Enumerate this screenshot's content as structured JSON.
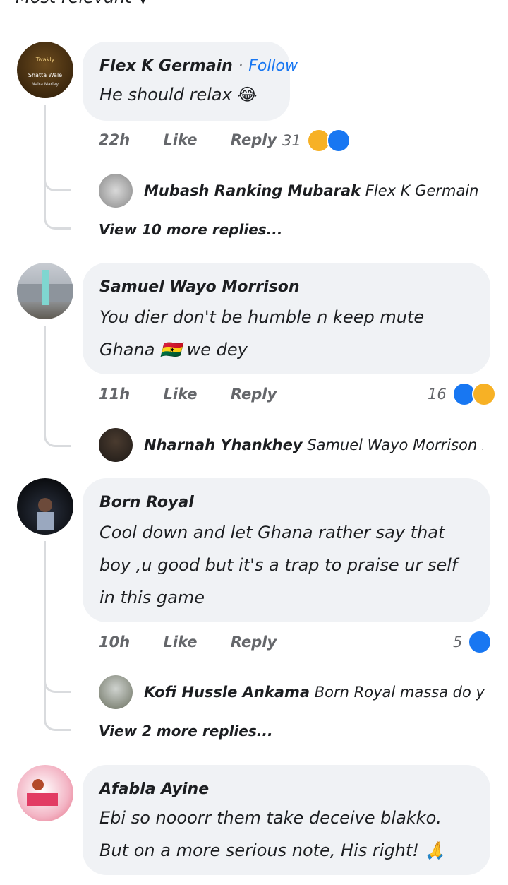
{
  "sort_label": "Most relevant",
  "comments": [
    {
      "author": "Flex K Germain",
      "follow": "Follow",
      "dot": "·",
      "lines": [
        "He should relax 😂"
      ],
      "time": "22h",
      "like": "Like",
      "reply": "Reply",
      "reactions_count": "31",
      "replies": [
        {
          "name": "Mubash Ranking Mubarak",
          "text": "Flex K Germain  s..."
        }
      ],
      "more_replies": "View 10 more replies..."
    },
    {
      "author": "Samuel Wayo Morrison",
      "lines": [
        "You dier don't be humble n keep mute",
        "Ghana 🇬🇭 we dey"
      ],
      "time": "11h",
      "like": "Like",
      "reply": "Reply",
      "reactions_count": "16",
      "replies": [
        {
          "name": "Nharnah Yhankhey",
          "text": "Samuel Wayo Morrison h..."
        }
      ]
    },
    {
      "author": "Born Royal",
      "lines": [
        "Cool down and let Ghana rather say that",
        "boy ,u good but it's a trap to praise ur self",
        "in this game"
      ],
      "time": "10h",
      "like": "Like",
      "reply": "Reply",
      "reactions_count": "5",
      "replies": [
        {
          "name": "Kofi Hussle Ankama",
          "text": "Born Royal massa do yo ..."
        }
      ],
      "more_replies": "View 2 more replies..."
    },
    {
      "author": "Afabla Ayine",
      "lines": [
        "Ebi so nooorr them take deceive blakko.",
        "But on a more serious note, His right! 🙏"
      ]
    }
  ],
  "colors": {
    "accent": "#1877f2",
    "bubble": "#f0f2f5",
    "meta": "#65676b"
  }
}
